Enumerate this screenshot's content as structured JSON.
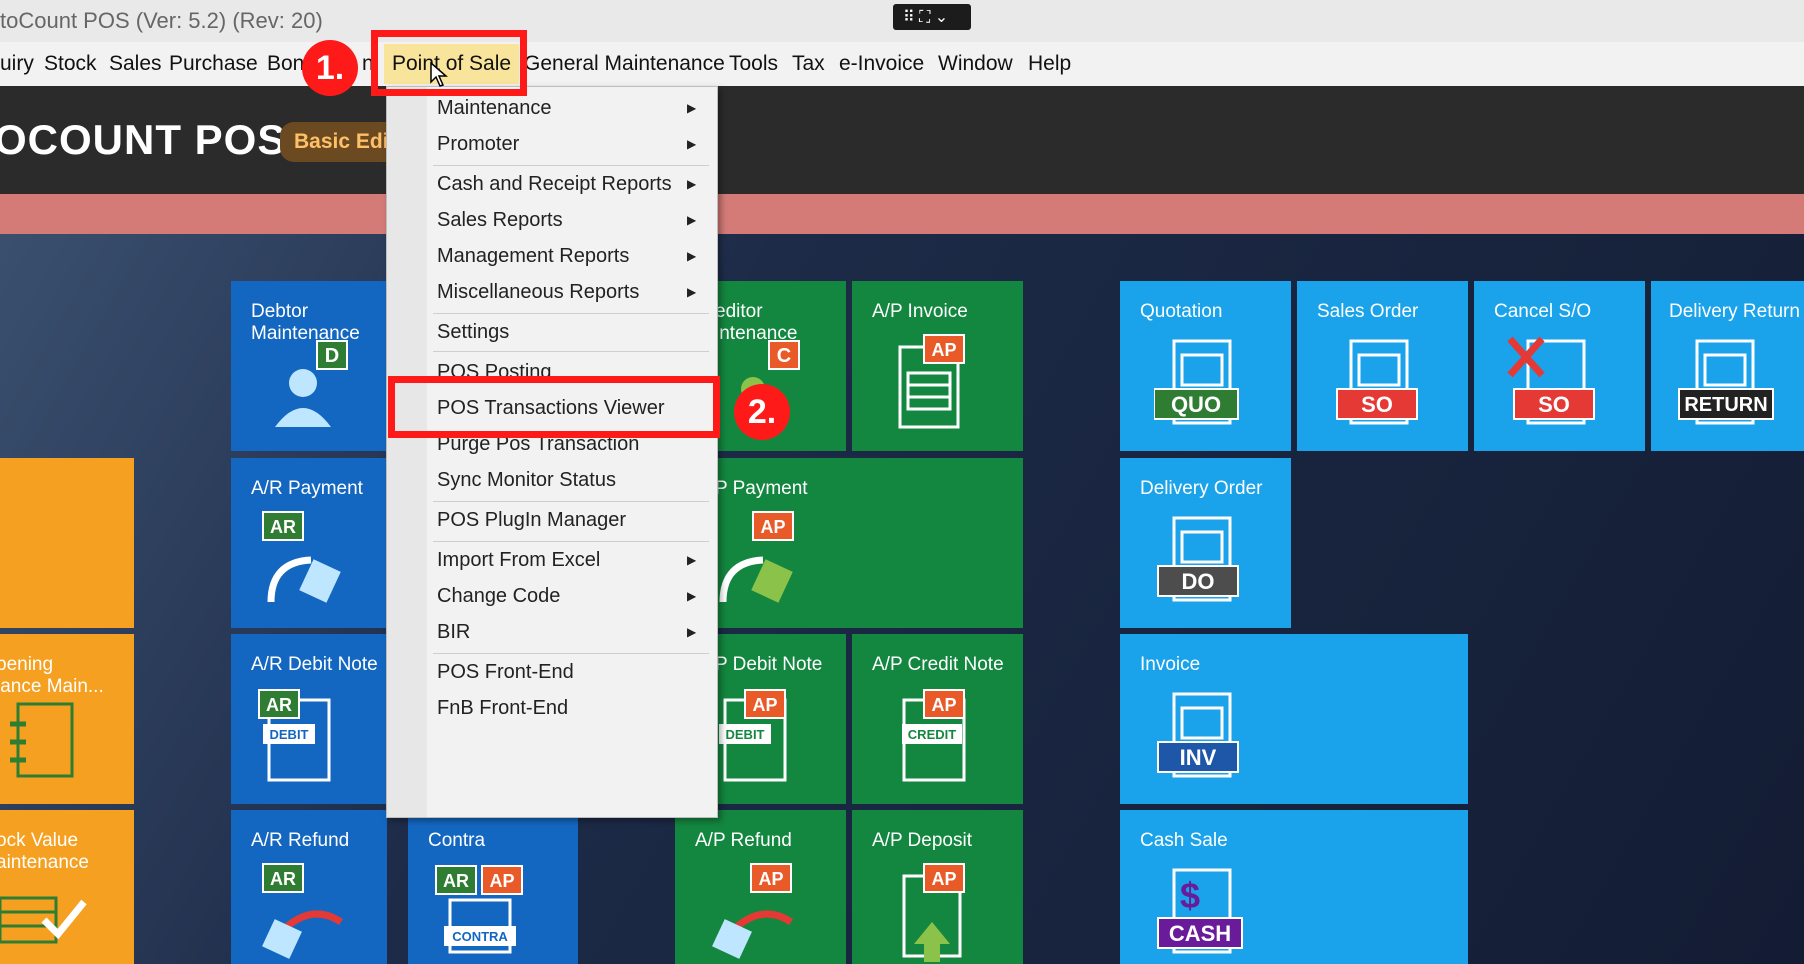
{
  "window": {
    "title": "toCount POS (Ver: 5.2) (Rev: 20)",
    "widget_glyph": "⠿ ⛶ ⌄"
  },
  "menubar": {
    "items": [
      "uiry",
      "Stock",
      "Sales",
      "Purchase",
      "Bon",
      "n",
      "Point of Sale",
      "General Maintenance",
      "Tools",
      "Tax",
      "e-Invoice",
      "Window",
      "Help"
    ]
  },
  "header": {
    "brand": "OCOUNT POS",
    "edition": "Basic Edi"
  },
  "dropdown": {
    "items": [
      {
        "label": "Maintenance",
        "submenu": true
      },
      {
        "label": "Promoter",
        "submenu": true
      },
      {
        "label": "Cash and Receipt Reports",
        "submenu": true
      },
      {
        "label": "Sales Reports",
        "submenu": true
      },
      {
        "label": "Management Reports",
        "submenu": true
      },
      {
        "label": "Miscellaneous Reports",
        "submenu": true
      },
      {
        "label": "Settings",
        "submenu": false
      },
      {
        "label": "POS Posting",
        "submenu": false
      },
      {
        "label": "POS Transactions Viewer",
        "submenu": false
      },
      {
        "label": "Purge Pos Transaction",
        "submenu": false
      },
      {
        "label": "Sync Monitor Status",
        "submenu": false
      },
      {
        "label": "POS PlugIn Manager",
        "submenu": false
      },
      {
        "label": "Import From Excel",
        "submenu": true
      },
      {
        "label": "Change Code",
        "submenu": true
      },
      {
        "label": "BIR",
        "submenu": true
      },
      {
        "label": "POS Front-End",
        "submenu": false
      },
      {
        "label": "FnB Front-End",
        "submenu": false
      }
    ],
    "arrow_glyph": "▶"
  },
  "annotations": {
    "step1": "1.",
    "step2": "2."
  },
  "tiles": {
    "debtor_maintenance": {
      "label": "Debtor\nMaintenance",
      "icon": "D"
    },
    "ar_payment": {
      "label": "A/R Payment",
      "icon": "AR"
    },
    "ar_debit_note": {
      "label": "A/R Debit Note",
      "icon": "AR",
      "sub": "DEBIT"
    },
    "ar_refund": {
      "label": "A/R Refund",
      "icon": "AR"
    },
    "contra": {
      "label": "Contra",
      "icon": "AR AP",
      "sub": "CONTRA"
    },
    "creditor_maintenance": {
      "label": "editor\nintenance",
      "icon": "C"
    },
    "ap_invoice": {
      "label": "A/P Invoice",
      "icon": "AP"
    },
    "ap_payment": {
      "label": "P Payment",
      "icon": "AP"
    },
    "ap_debit_note": {
      "label": "P Debit Note",
      "icon": "AP",
      "sub": "DEBIT"
    },
    "ap_credit_note": {
      "label": "A/P Credit Note",
      "icon": "AP",
      "sub": "CREDIT"
    },
    "ap_refund": {
      "label": "A/P Refund",
      "icon": "AP"
    },
    "ap_deposit": {
      "label": "A/P Deposit",
      "icon": "AP"
    },
    "quotation": {
      "label": "Quotation",
      "icon": "QUO"
    },
    "sales_order": {
      "label": "Sales Order",
      "icon": "SO"
    },
    "cancel_so": {
      "label": "Cancel S/O",
      "icon": "SO"
    },
    "delivery_return": {
      "label": "Delivery Return",
      "icon": "RETURN"
    },
    "delivery_order": {
      "label": "Delivery Order",
      "icon": "DO"
    },
    "invoice": {
      "label": "Invoice",
      "icon": "INV"
    },
    "cash_sale": {
      "label": "Cash Sale",
      "icon": "CASH"
    },
    "opening_balance": {
      "label": "pening\nlance Main..."
    },
    "stock_value": {
      "label": "ock Value\naintenance"
    }
  }
}
